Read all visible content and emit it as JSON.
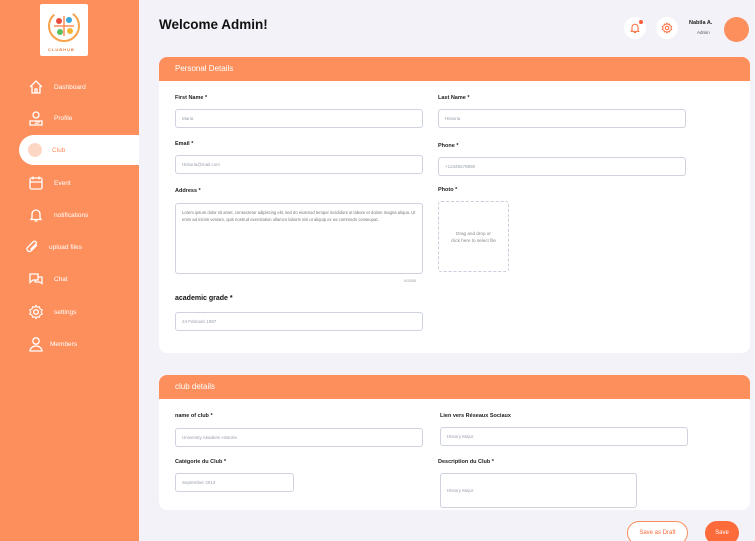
{
  "sidebar": {
    "brand_text": "CLUBHUB",
    "items": [
      {
        "label": "Dashboard",
        "icon": "home-icon"
      },
      {
        "label": "Profile",
        "icon": "profile-icon"
      },
      {
        "label": "Club",
        "icon": "club-icon",
        "active": true
      },
      {
        "label": "Event",
        "icon": "calendar-icon"
      },
      {
        "label": "notifications",
        "icon": "bell-icon"
      },
      {
        "label": "upload files",
        "icon": "paperclip-icon"
      },
      {
        "label": "Chat",
        "icon": "chat-icon"
      },
      {
        "label": "settings",
        "icon": "gear-icon"
      },
      {
        "label": "Members",
        "icon": "user-icon"
      }
    ]
  },
  "header": {
    "title": "Welcome Admin!",
    "user_name": "Nabila A.",
    "user_role": "Admin"
  },
  "personal": {
    "heading": "Personal Details",
    "first_name_label": "First Name *",
    "first_name_value": "Maria",
    "last_name_label": "Last Name *",
    "last_name_value": "Historia",
    "email_label": "Email *",
    "email_value": "Historia@mail.com",
    "phone_label": "Phone *",
    "phone_value": "+12345678890",
    "address_label": "Address *",
    "address_value": "Lorem ipsum dolor sit amet, consectetur adipiscing elit, sed do eiusmod tempor incididunt ut labore et dolore magna aliqua. Ut enim ad minim veniam, quis nostrud exercitation ullamco laboris nisi ut aliquip ex ea commodo consequat.",
    "address_counter": "0/2000",
    "photo_label": "Photo *",
    "photo_line1": "Drag and drop or",
    "photo_line2": "click here to select file",
    "grade_label": "academic grade *",
    "grade_value": "24 Februari 1997"
  },
  "club": {
    "heading": "club details",
    "name_label": "name of club *",
    "name_value": "University Akademi Historia",
    "social_label": "Lien vers Réseaux Sociaux",
    "social_value": "History Major",
    "category_label": "Catégorie du Club *",
    "category_value": "September 2013",
    "description_label": "Description du Club *",
    "description_value": "History Major"
  },
  "actions": {
    "draft_label": "Save as Draft",
    "save_label": "Save"
  },
  "colors": {
    "accent": "#fd8f5c",
    "save": "#fd6b3a",
    "background": "#f3f2f9"
  }
}
